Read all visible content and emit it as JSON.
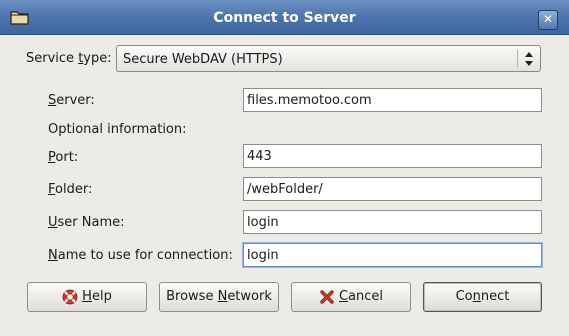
{
  "window": {
    "title": "Connect to Server",
    "close_glyph": "✕",
    "icon": "folder-icon"
  },
  "service": {
    "label_pre": "Service ",
    "label_u": "t",
    "label_post": "ype:",
    "value": "Secure WebDAV (HTTPS)"
  },
  "server": {
    "label_u": "S",
    "label_rest": "erver:",
    "value": "files.memotoo.com"
  },
  "optional_label": "Optional information:",
  "port": {
    "label_u": "P",
    "label_rest": "ort:",
    "value": "443"
  },
  "folder": {
    "label_u": "F",
    "label_rest": "older:",
    "value": "/webFolder/"
  },
  "username": {
    "label_u": "U",
    "label_rest": "ser Name:",
    "value": "login"
  },
  "connname": {
    "label_u": "N",
    "label_rest": "ame to use for connection:",
    "value": "login"
  },
  "buttons": {
    "help": {
      "u": "H",
      "rest": "elp",
      "icon": "help-lifebuoy-icon"
    },
    "browse": {
      "pre": "Browse ",
      "u": "N",
      "rest": "etwork"
    },
    "cancel": {
      "u": "C",
      "rest": "ancel",
      "icon": "cancel-x-icon"
    },
    "connect": {
      "pre": "Co",
      "u": "n",
      "rest": "nect"
    }
  },
  "colors": {
    "titlebar": "#4d74ad",
    "window_bg": "#ecebe6",
    "cancel_icon": "#c0392b",
    "help_icon": "#d23b2e"
  }
}
